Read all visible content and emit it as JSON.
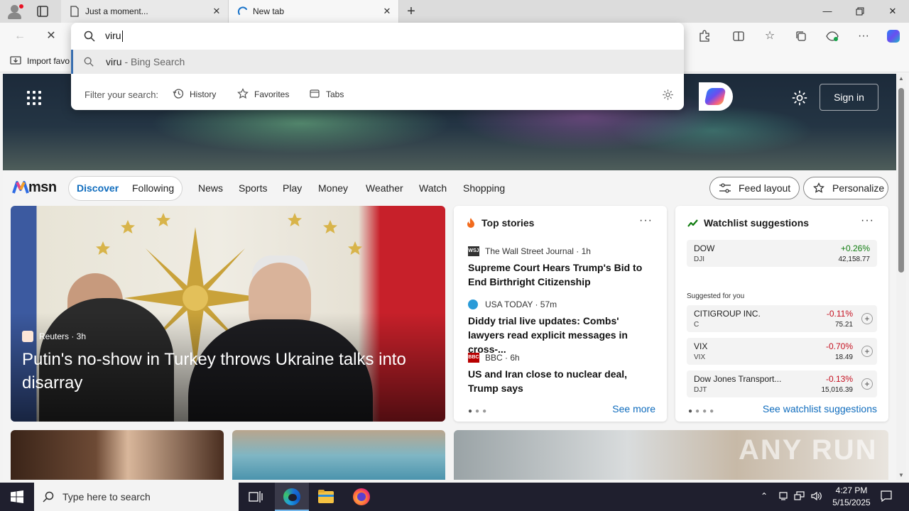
{
  "tabs": [
    {
      "title": "Just a moment...",
      "active": false
    },
    {
      "title": "New tab",
      "active": true
    }
  ],
  "omnibox": {
    "query": "viru",
    "suggestion": {
      "term": "viru",
      "suffix": " - Bing Search"
    },
    "filter_label": "Filter your search:",
    "filters": [
      "History",
      "Favorites",
      "Tabs"
    ]
  },
  "favorites_bar": {
    "import_label": "Import favo"
  },
  "msn": {
    "logo": "msn",
    "sign_in": "Sign in",
    "pill": {
      "discover": "Discover",
      "following": "Following"
    },
    "nav": [
      "News",
      "Sports",
      "Play",
      "Money",
      "Weather",
      "Watch",
      "Shopping"
    ],
    "feed_layout": "Feed layout",
    "personalize": "Personalize"
  },
  "hero_story": {
    "source": "Reuters · 3h",
    "headline": "Putin's no-show in Turkey throws Ukraine talks into disarray"
  },
  "top_stories": {
    "title": "Top stories",
    "items": [
      {
        "logo": "WSJ",
        "source": "The Wall Street Journal · 1h",
        "headline": "Supreme Court Hears Trump's Bid to End Birthright Citizenship"
      },
      {
        "logo": "",
        "source": "USA TODAY · 57m",
        "headline": "Diddy trial live updates: Combs' lawyers read explicit messages in cross-..."
      },
      {
        "logo": "BBC",
        "source": "BBC · 6h",
        "headline": "US and Iran close to nuclear deal, Trump says"
      }
    ],
    "see_more": "See more"
  },
  "watchlist": {
    "title": "Watchlist suggestions",
    "suggested_label": "Suggested for you",
    "main": {
      "name": "DOW",
      "ticker": "DJI",
      "change": "+0.26%",
      "price": "42,158.77"
    },
    "items": [
      {
        "name": "CITIGROUP INC.",
        "ticker": "C",
        "change": "-0.11%",
        "price": "75.21"
      },
      {
        "name": "VIX",
        "ticker": "VIX",
        "change": "-0.70%",
        "price": "18.49"
      },
      {
        "name": "Dow Jones Transport...",
        "ticker": "DJT",
        "change": "-0.13%",
        "price": "15,016.39"
      }
    ],
    "see_link": "See watchlist suggestions"
  },
  "taskbar": {
    "search_placeholder": "Type here to search",
    "time": "4:27 PM",
    "date": "5/15/2025"
  },
  "watermark": "ANY RUN",
  "colors": {
    "accent": "#0f6cbd",
    "up": "#107c10",
    "down": "#c50f1f",
    "taskbar": "#1f1f2e"
  }
}
